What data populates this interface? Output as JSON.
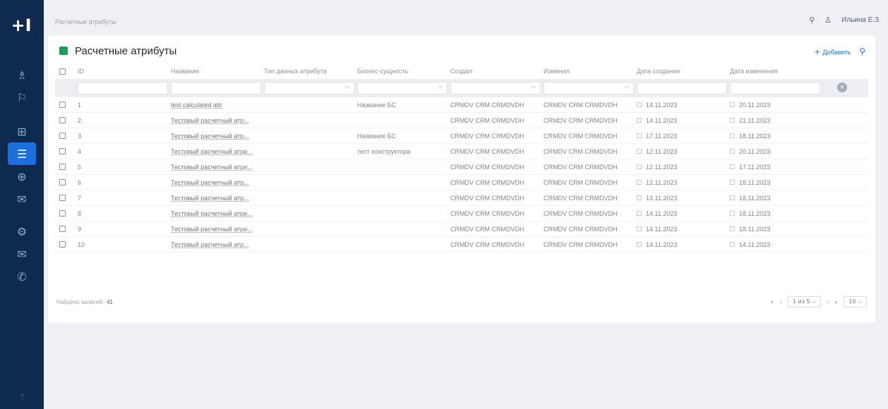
{
  "sidebar": {
    "logo": "+I",
    "items": [
      {
        "name": "nav-users-icon",
        "glyph": "♗"
      },
      {
        "name": "nav-flag-icon",
        "glyph": "⚐"
      },
      {
        "name": "nav-grid-icon",
        "glyph": "⊞"
      },
      {
        "name": "nav-list-icon",
        "glyph": "☰",
        "active": true
      },
      {
        "name": "nav-globe-icon",
        "glyph": "⊕"
      },
      {
        "name": "nav-mail-icon",
        "glyph": "✉"
      },
      {
        "name": "nav-settings-icon",
        "glyph": "⚙"
      },
      {
        "name": "nav-message-icon",
        "glyph": "✉"
      },
      {
        "name": "nav-phone-icon",
        "glyph": "✆"
      }
    ],
    "bottom": "?"
  },
  "topbar": {
    "breadcrumb": "Расчетные атрибуты",
    "search_icon": "⚲",
    "user_icon": "♙",
    "user_name": "Ильина Е.З."
  },
  "page": {
    "title": "Расчетные атрибуты",
    "add_label": "Добавить",
    "add_icon": "+",
    "search_icon": "⚲"
  },
  "table": {
    "columns": [
      "ID",
      "Название",
      "Тип данных атрибута",
      "Бизнес-сущность",
      "Создал",
      "Изменил",
      "Дата создания",
      "Дата изменения"
    ],
    "rows": [
      {
        "id": "1",
        "name": "test calculated attr",
        "type": "",
        "entity": "Название БС",
        "created_by": "CRMDV CRM CRMDVDH",
        "changed_by": "CRMDV CRM CRMDVDH",
        "created": "14.11.2023",
        "changed": "20.11.2023"
      },
      {
        "id": "2",
        "name": "Тестовый расчетный атр...",
        "type": "",
        "entity": "",
        "created_by": "CRMDV CRM CRMDVDH",
        "changed_by": "CRMDV CRM CRMDVDH",
        "created": "14.11.2023",
        "changed": "21.11.2023"
      },
      {
        "id": "3",
        "name": "Тестовый расчетный атр...",
        "type": "",
        "entity": "Название БС",
        "created_by": "CRMDV CRM CRMDVDH",
        "changed_by": "CRMDV CRM CRMDVDH",
        "created": "17.11.2023",
        "changed": "18.11.2023"
      },
      {
        "id": "4",
        "name": "Тестовый расчетный атри...",
        "type": "",
        "entity": "тест конструктора",
        "created_by": "CRMDV CRM CRMDVDH",
        "changed_by": "CRMDV CRM CRMDVDH",
        "created": "12.11.2023",
        "changed": "20.11.2023"
      },
      {
        "id": "5",
        "name": "Тестовый расчетный атри...",
        "type": "",
        "entity": "",
        "created_by": "CRMDV CRM CRMDVDH",
        "changed_by": "CRMDV CRM CRMDVDH",
        "created": "12.11.2023",
        "changed": "17.11.2023"
      },
      {
        "id": "6",
        "name": "Тестовый расчетный атр...",
        "type": "",
        "entity": "",
        "created_by": "CRMDV CRM CRMDVDH",
        "changed_by": "CRMDV CRM CRMDVDH",
        "created": "12.11.2023",
        "changed": "18.11.2023"
      },
      {
        "id": "7",
        "name": "Тестовый расчетный атр...",
        "type": "",
        "entity": "",
        "created_by": "CRMDV CRM CRMDVDH",
        "changed_by": "CRMDV CRM CRMDVDH",
        "created": "13.11.2023",
        "changed": "18.11.2023"
      },
      {
        "id": "8",
        "name": "Тестовый расчетный атри...",
        "type": "",
        "entity": "",
        "created_by": "CRMDV CRM CRMDVDH",
        "changed_by": "CRMDV CRM CRMDVDH",
        "created": "14.11.2023",
        "changed": "18.11.2023"
      },
      {
        "id": "9",
        "name": "Тестовый расчетный атри...",
        "type": "",
        "entity": "",
        "created_by": "CRMDV CRM CRMDVDH",
        "changed_by": "CRMDV CRM CRMDVDH",
        "created": "14.11.2023",
        "changed": "18.11.2023"
      },
      {
        "id": "10",
        "name": "Тестовый расчетный атр...",
        "type": "",
        "entity": "",
        "created_by": "CRMDV CRM CRMDVDH",
        "changed_by": "CRMDV CRM CRMDVDH",
        "created": "14.11.2023",
        "changed": "14.11.2023"
      }
    ]
  },
  "footer": {
    "total_label": "Найдено записей:",
    "total_value": "41",
    "first_icon": "«",
    "prev_icon": "‹",
    "page_select": "1 из 5 ⌵",
    "next_icon": "›",
    "last_icon": "»",
    "page_size": "10 ⌵"
  },
  "colors": {
    "sidebar": "#0f2a4f",
    "accent": "#1d6fe0",
    "title_badge": "#1aa05a"
  }
}
